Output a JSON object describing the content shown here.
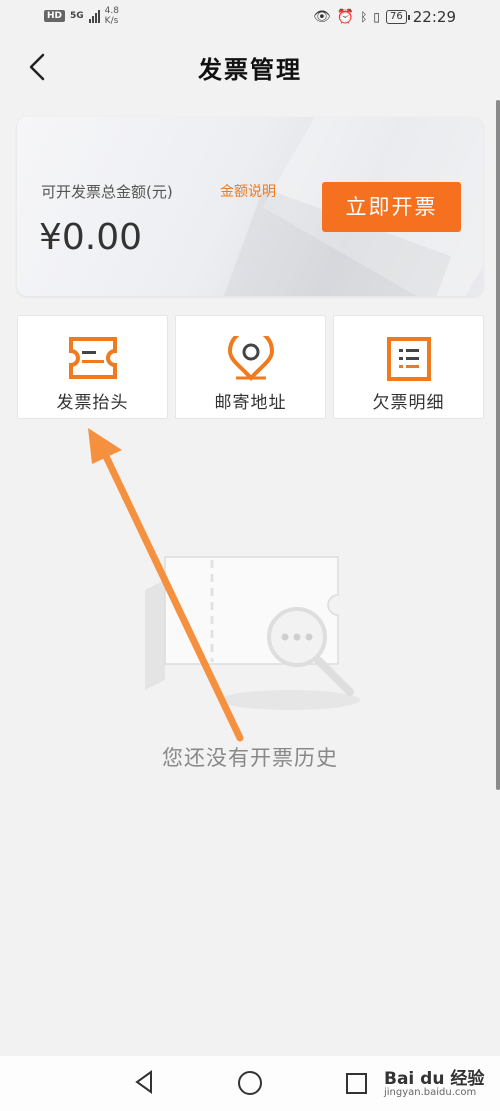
{
  "status_bar": {
    "hd": "HD",
    "network": "5G",
    "speed_value": "4.8",
    "speed_unit": "K/s",
    "battery": "76",
    "time": "22:29"
  },
  "header": {
    "title": "发票管理"
  },
  "summary": {
    "label": "可开发票总金额(元)",
    "help_link": "金额说明",
    "amount": "¥0.00",
    "issue_button": "立即开票"
  },
  "tiles": [
    {
      "label": "发票抬头",
      "icon": "ticket-icon"
    },
    {
      "label": "邮寄地址",
      "icon": "location-pin-icon"
    },
    {
      "label": "欠票明细",
      "icon": "list-detail-icon"
    }
  ],
  "empty_state": {
    "message": "您还没有开票历史"
  },
  "navbar": {
    "watermark": "Bai du 经验",
    "watermark_sub": "jingyan.baidu.com"
  },
  "colors": {
    "accent": "#f6711f",
    "annotation_arrow": "#f5913e"
  }
}
